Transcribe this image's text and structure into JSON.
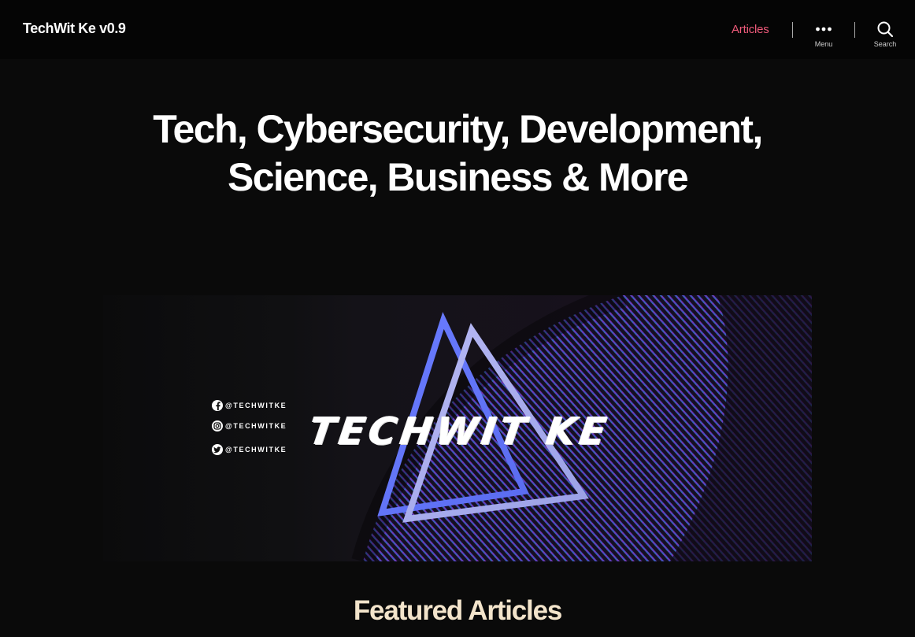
{
  "header": {
    "site_title": "TechWit Ke v0.9",
    "nav_link": "Articles",
    "menu_label": "Menu",
    "search_label": "Search"
  },
  "hero": {
    "title": "Tech, Cybersecurity, Development, Science, Business & More"
  },
  "banner": {
    "brand_text": "TECHWIT KE",
    "socials": [
      {
        "icon": "facebook-icon",
        "handle": "@TECHWITKE"
      },
      {
        "icon": "instagram-icon",
        "handle": "@TECHWITKE"
      },
      {
        "icon": "twitter-icon",
        "handle": "@TECHWITKE"
      }
    ]
  },
  "section": {
    "featured_heading": "Featured Articles"
  },
  "colors": {
    "accent": "#ee5a7a",
    "featured_heading": "#f3e4cb",
    "background": "#0a0a0a"
  }
}
